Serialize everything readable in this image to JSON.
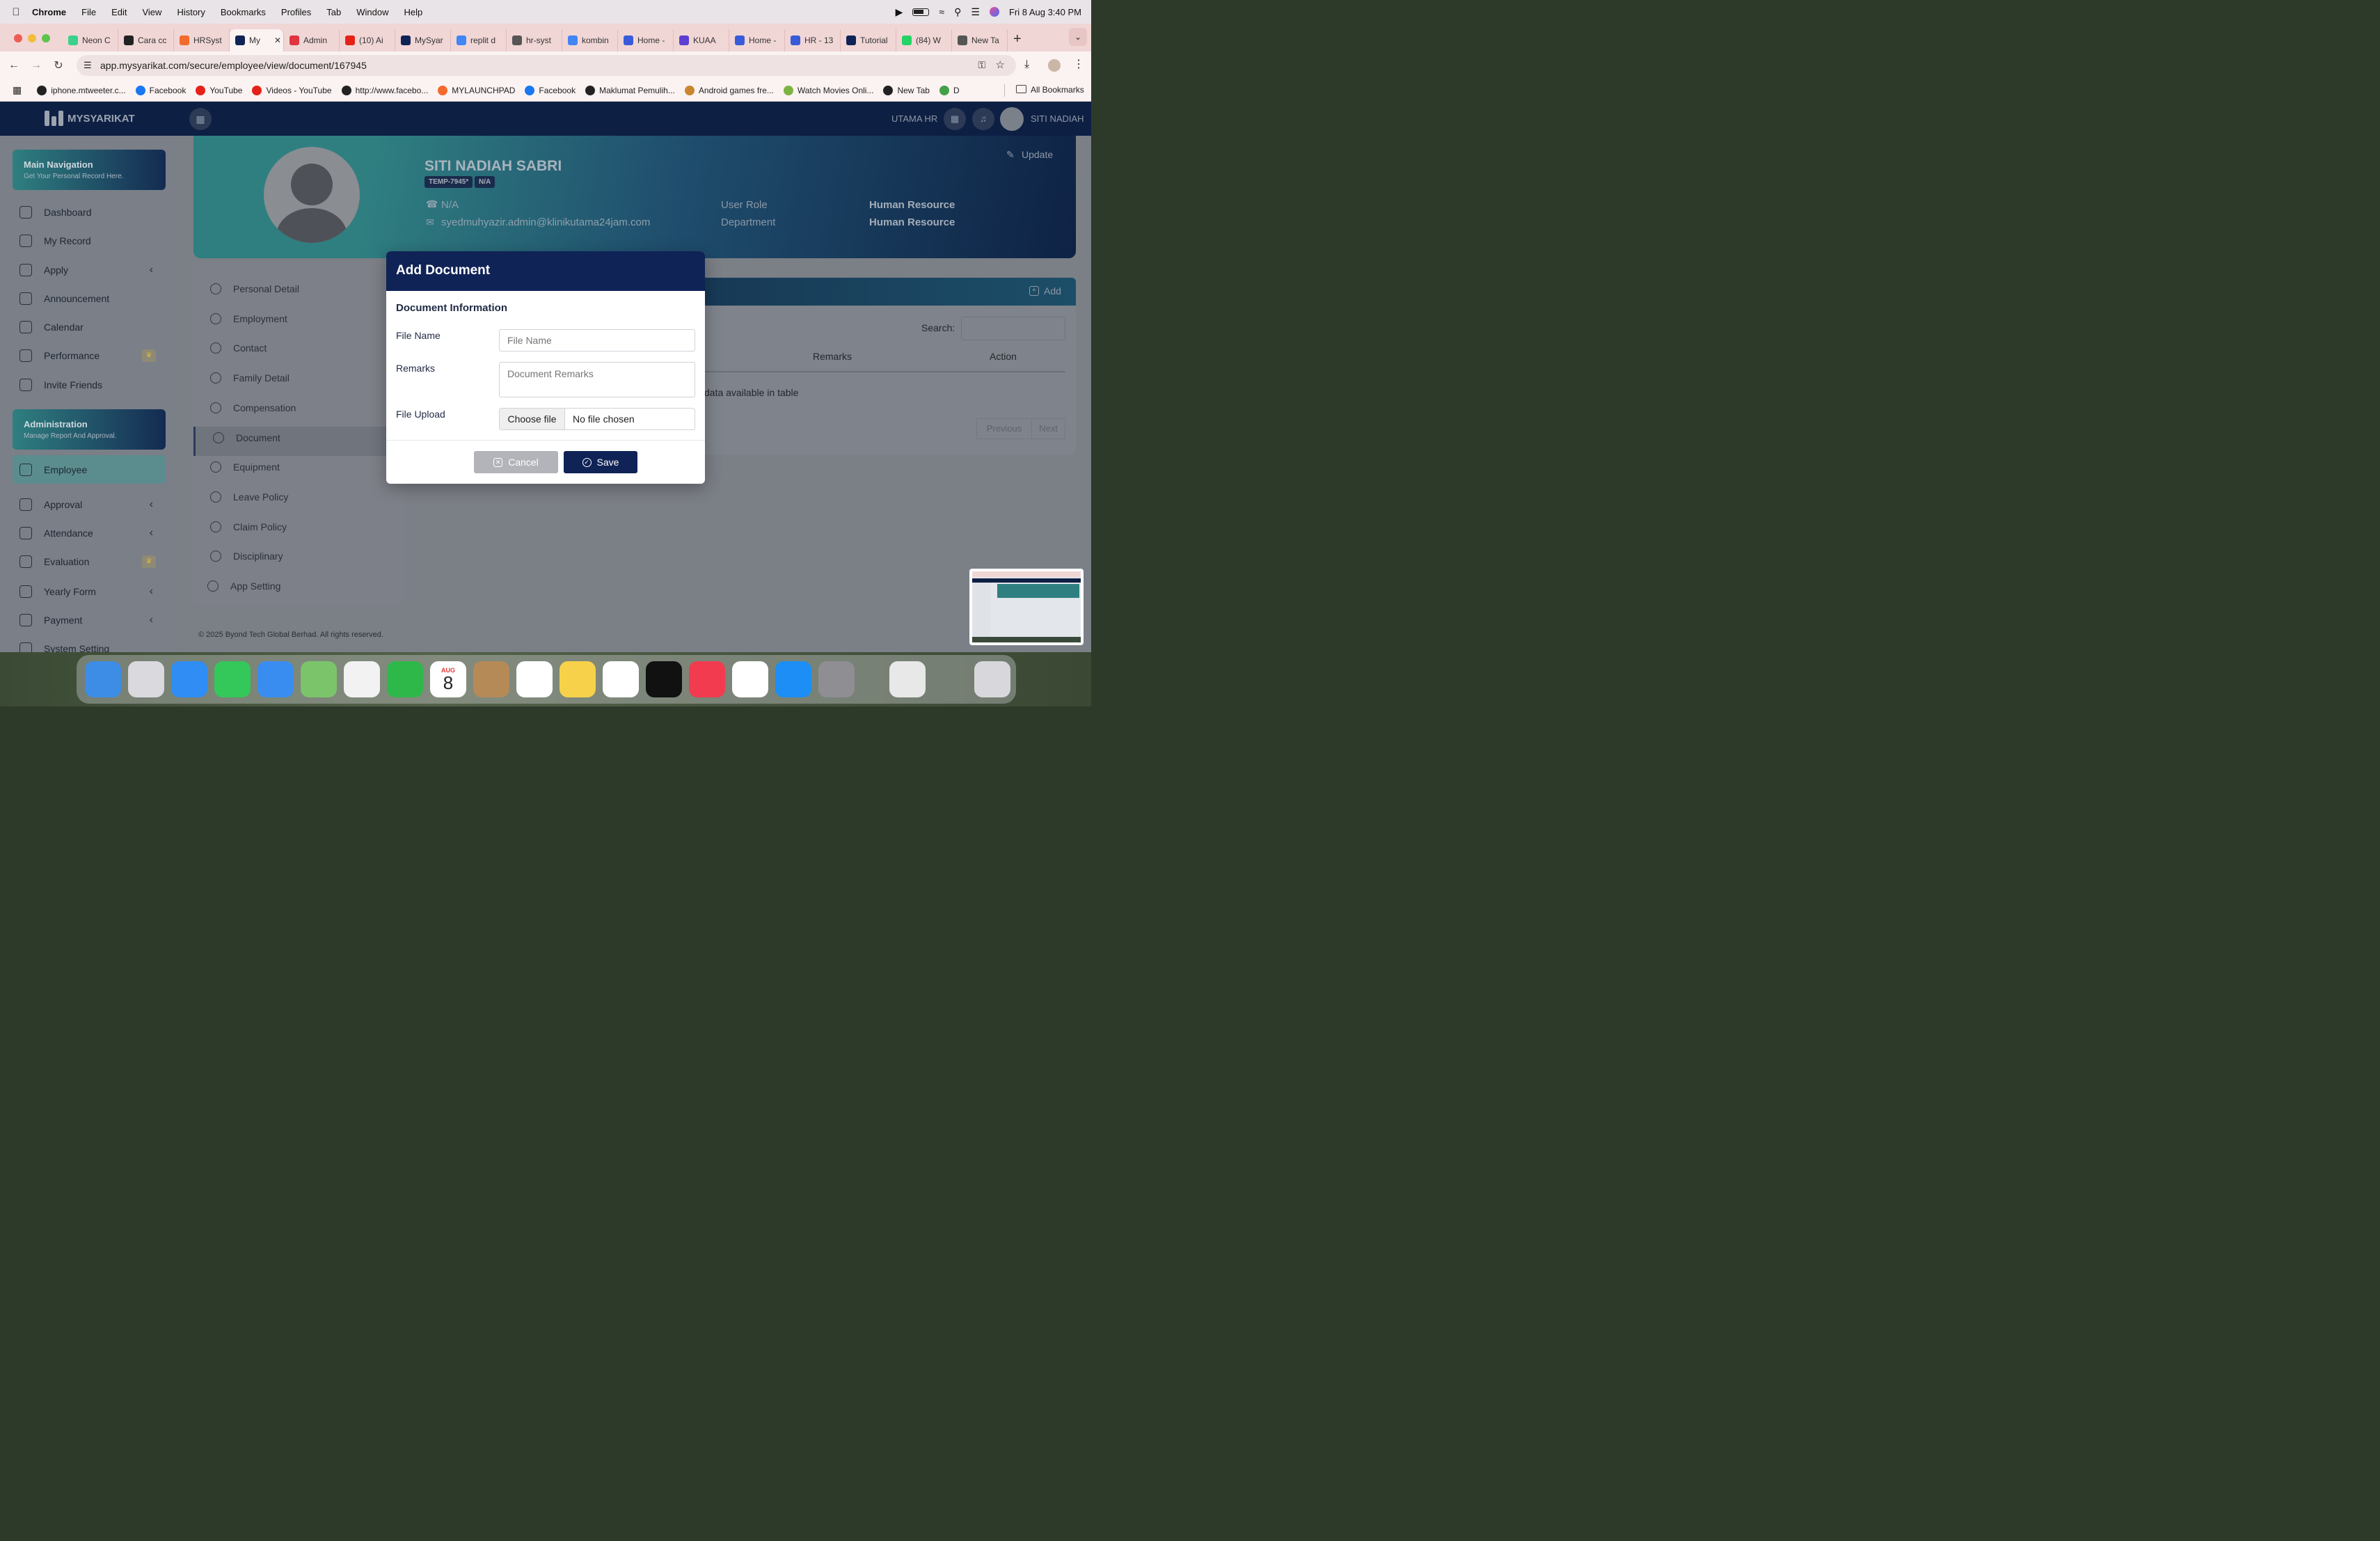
{
  "menubar": {
    "app": "Chrome",
    "items": [
      "File",
      "Edit",
      "View",
      "History",
      "Bookmarks",
      "Profiles",
      "Tab",
      "Window",
      "Help"
    ],
    "datetime": "Fri 8 Aug  3:40 PM"
  },
  "tabs": [
    {
      "label": "Neon C",
      "color": "#3bd18c"
    },
    {
      "label": "Cara cc",
      "color": "#222222"
    },
    {
      "label": "HRSyst",
      "color": "#f26b2c"
    },
    {
      "label": "My",
      "color": "#0f2356"
    },
    {
      "label": "Admin",
      "color": "#e0343f"
    },
    {
      "label": "(10) Ai",
      "color": "#e62117"
    },
    {
      "label": "MySyar",
      "color": "#0f2356"
    },
    {
      "label": "replit d",
      "color": "#4285f4"
    },
    {
      "label": "hr-syst",
      "color": "#555555"
    },
    {
      "label": "kombin",
      "color": "#4285f4"
    },
    {
      "label": "Home -",
      "color": "#3a5bd9"
    },
    {
      "label": "KUAA",
      "color": "#5b3fd1"
    },
    {
      "label": "Home -",
      "color": "#3a5bd9"
    },
    {
      "label": "HR - 13",
      "color": "#3a5bd9"
    },
    {
      "label": "Tutorial",
      "color": "#0f2356"
    },
    {
      "label": "(84) W",
      "color": "#25d366"
    },
    {
      "label": "New Ta",
      "color": "#555555"
    }
  ],
  "address": {
    "url": "app.mysyarikat.com/secure/employee/view/document/167945"
  },
  "bookmarks": [
    {
      "label": "iphone.mtweeter.c...",
      "color": "#222222"
    },
    {
      "label": "Facebook",
      "color": "#1877f2"
    },
    {
      "label": "YouTube",
      "color": "#e62117"
    },
    {
      "label": "Videos - YouTube",
      "color": "#e62117"
    },
    {
      "label": "http://www.facebo...",
      "color": "#222222"
    },
    {
      "label": "MYLAUNCHPAD",
      "color": "#f26b2c"
    },
    {
      "label": "Facebook",
      "color": "#1877f2"
    },
    {
      "label": "Maklumat Pemulih...",
      "color": "#222222"
    },
    {
      "label": "Android games fre...",
      "color": "#c9862e"
    },
    {
      "label": "Watch Movies Onli...",
      "color": "#7cb342"
    },
    {
      "label": "New Tab",
      "color": "#222222"
    },
    {
      "label": "D",
      "color": "#43a047"
    }
  ],
  "all_bookmarks": "All Bookmarks",
  "app": {
    "brand": "MYSYARIKAT",
    "company": "UTAMA HR",
    "user": "SITI NADIAH"
  },
  "sidebar": {
    "main_nav": {
      "title": "Main Navigation",
      "subtitle": "Get Your Personal Record Here."
    },
    "main_items": [
      {
        "label": "Dashboard",
        "chevron": false,
        "crown": false
      },
      {
        "label": "My Record",
        "chevron": false,
        "crown": false
      },
      {
        "label": "Apply",
        "chevron": true,
        "crown": false
      },
      {
        "label": "Announcement",
        "chevron": false,
        "crown": false
      },
      {
        "label": "Calendar",
        "chevron": false,
        "crown": false
      },
      {
        "label": "Performance",
        "chevron": false,
        "crown": true
      },
      {
        "label": "Invite Friends",
        "chevron": false,
        "crown": false
      }
    ],
    "admin": {
      "title": "Administration",
      "subtitle": "Manage Report And Approval."
    },
    "admin_items": [
      {
        "label": "Employee",
        "chevron": false,
        "crown": false
      },
      {
        "label": "Approval",
        "chevron": true,
        "crown": false
      },
      {
        "label": "Attendance",
        "chevron": true,
        "crown": false
      },
      {
        "label": "Evaluation",
        "chevron": false,
        "crown": true
      },
      {
        "label": "Yearly Form",
        "chevron": true,
        "crown": false
      },
      {
        "label": "Payment",
        "chevron": true,
        "crown": false
      },
      {
        "label": "System Setting",
        "chevron": false,
        "crown": false
      }
    ]
  },
  "profile": {
    "name": "SITI NADIAH SABRI",
    "code": "TEMP-7945*",
    "tag": "N/A",
    "phone": "N/A",
    "email": "syedmuhyazir.admin@klinikutama24jam.com",
    "role_label": "User Role",
    "role_value": "Human Resource",
    "dept_label": "Department",
    "dept_value": "Human Resource",
    "update": "Update"
  },
  "profile_tabs": [
    "Personal Detail",
    "Employment",
    "Contact",
    "Family Detail",
    "Compensation",
    "Document",
    "Equipment",
    "Leave Policy",
    "Claim Policy",
    "Disciplinary",
    "App Setting"
  ],
  "doc_panel": {
    "add": "Add",
    "search_label": "Search:",
    "col_remarks": "Remarks",
    "col_action": "Action",
    "empty": "data available in table",
    "prev": "Previous",
    "next": "Next"
  },
  "footer": "© 2025 Byond Tech Global Berhad. All rights reserved.",
  "modal": {
    "title": "Add Document",
    "section": "Document Information",
    "file_name_label": "File Name",
    "file_name_placeholder": "File Name",
    "remarks_label": "Remarks",
    "remarks_placeholder": "Document Remarks",
    "upload_label": "File Upload",
    "choose": "Choose file",
    "no_file": "No file chosen",
    "cancel": "Cancel",
    "save": "Save"
  },
  "dock": {
    "calendar_month": "AUG",
    "calendar_day": "8",
    "apps": [
      {
        "name": "finder",
        "color": "#3d8de6"
      },
      {
        "name": "launchpad",
        "color": "#d9d9de"
      },
      {
        "name": "safari",
        "color": "#2f8df3"
      },
      {
        "name": "messages",
        "color": "#34c759"
      },
      {
        "name": "mail",
        "color": "#3a8df0"
      },
      {
        "name": "maps",
        "color": "#7bc46a"
      },
      {
        "name": "photos",
        "color": "#f2f2f2"
      },
      {
        "name": "facetime",
        "color": "#2fb84a"
      },
      {
        "name": "calendar",
        "color": "#ffffff"
      },
      {
        "name": "contacts",
        "color": "#b58a57"
      },
      {
        "name": "reminders",
        "color": "#ffffff"
      },
      {
        "name": "notes",
        "color": "#f7d14a"
      },
      {
        "name": "freeform",
        "color": "#ffffff"
      },
      {
        "name": "apple-tv",
        "color": "#111111"
      },
      {
        "name": "music",
        "color": "#f23b4f"
      },
      {
        "name": "chrome",
        "color": "#ffffff"
      },
      {
        "name": "app-store",
        "color": "#1c8ef5"
      },
      {
        "name": "system-settings",
        "color": "#8e8e93"
      },
      {
        "name": "pdf-document",
        "color": "#e8e8e8"
      },
      {
        "name": "trash",
        "color": "#d8d8dc"
      }
    ]
  }
}
